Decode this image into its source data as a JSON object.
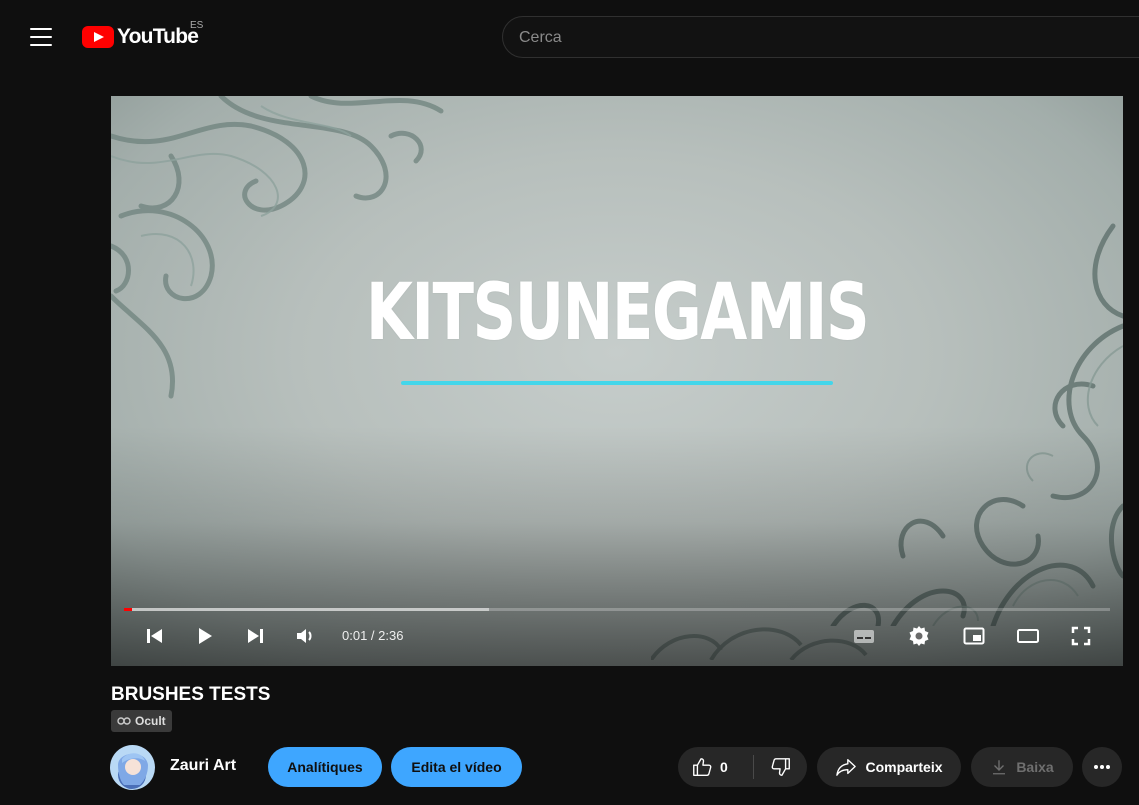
{
  "header": {
    "logo_text": "YouTube",
    "country_code": "ES",
    "search_placeholder": "Cerca"
  },
  "player": {
    "overlay_title": "KITSUNEGAMIS",
    "time_current": "0:01",
    "time_separator": " / ",
    "time_total": "2:36",
    "progress_played": 0.006,
    "progress_loaded": 0.37
  },
  "video": {
    "title": "BRUSHES TESTS",
    "visibility_label": "Ocult"
  },
  "channel": {
    "name": "Zauri Art"
  },
  "actions": {
    "analytics_label": "Analítiques",
    "edit_label": "Edita el vídeo",
    "like_count": "0",
    "share_label": "Comparteix",
    "download_label": "Baixa"
  },
  "icons": {
    "menu": "menu-icon",
    "prev": "skip-previous-icon",
    "play": "play-icon",
    "next": "skip-next-icon",
    "volume": "volume-icon",
    "captions": "captions-icon",
    "settings": "gear-icon",
    "miniplayer": "miniplayer-icon",
    "theater": "theater-mode-icon",
    "fullscreen": "fullscreen-icon",
    "link": "link-icon",
    "like": "thumbs-up-icon",
    "dislike": "thumbs-down-icon",
    "share": "share-arrow-icon",
    "download": "download-icon",
    "more": "more-horizontal-icon"
  },
  "colors": {
    "accent_blue": "#3ea6ff",
    "progress_red": "#ff0000",
    "title_underline": "#43d6ea",
    "background": "#0f0f0f",
    "pill": "#272727"
  }
}
